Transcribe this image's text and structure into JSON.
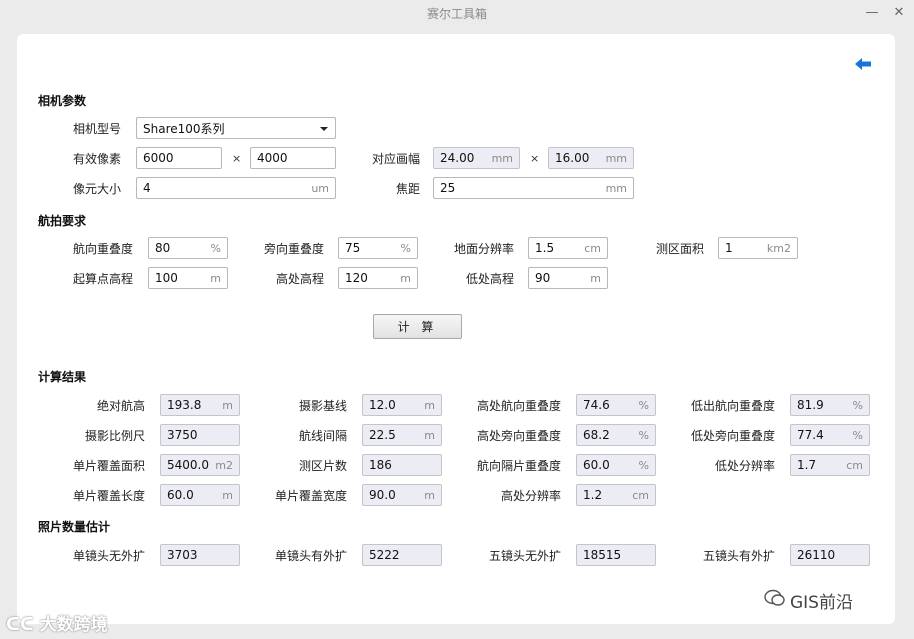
{
  "window": {
    "title": "赛尔工具箱",
    "minimize": "—",
    "close": "✕"
  },
  "colors": {
    "accent": "#1a73d9",
    "readonly_bg": "#ececf4"
  },
  "sections": {
    "camera": "相机参数",
    "flight": "航拍要求",
    "results": "计算结果",
    "photo_est": "照片数量估计"
  },
  "camera": {
    "model_label": "相机型号",
    "model_value": "Share100系列",
    "pixels_label": "有效像素",
    "pixels_w": "6000",
    "pixels_h": "4000",
    "frame_label": "对应画幅",
    "frame_w": "24.00",
    "frame_h": "16.00",
    "frame_unit": "mm",
    "pixel_size_label": "像元大小",
    "pixel_size": "4",
    "pixel_size_unit": "um",
    "focal_label": "焦距",
    "focal": "25",
    "focal_unit": "mm",
    "times": "×"
  },
  "flight": {
    "fwd_overlap_label": "航向重叠度",
    "fwd_overlap": "80",
    "pct": "%",
    "side_overlap_label": "旁向重叠度",
    "side_overlap": "75",
    "gsd_label": "地面分辨率",
    "gsd": "1.5",
    "gsd_unit": "cm",
    "area_label": "测区面积",
    "area": "1",
    "area_unit": "km2",
    "start_elev_label": "起算点高程",
    "start_elev": "100",
    "m": "m",
    "high_elev_label": "高处高程",
    "high_elev": "120",
    "low_elev_label": "低处高程",
    "low_elev": "90"
  },
  "calc_button": "计 算",
  "results": {
    "rel_alt_label": "绝对航高",
    "rel_alt": "193.8",
    "baseline_label": "摄影基线",
    "baseline": "12.0",
    "high_fwd_label": "高处航向重叠度",
    "high_fwd": "74.6",
    "low_fwd_label": "低出航向重叠度",
    "low_fwd": "81.9",
    "scale_label": "摄影比例尺",
    "scale": "3750",
    "line_spacing_label": "航线间隔",
    "line_spacing": "22.5",
    "high_side_label": "高处旁向重叠度",
    "high_side": "68.2",
    "low_side_label": "低处旁向重叠度",
    "low_side": "77.4",
    "cover_area_label": "单片覆盖面积",
    "cover_area": "5400.0",
    "cover_area_unit": "m2",
    "count_label": "测区片数",
    "count": "186",
    "skip_fwd_label": "航向隔片重叠度",
    "skip_fwd": "60.0",
    "low_gsd_label": "低处分辨率",
    "low_gsd": "1.7",
    "cm": "cm",
    "cover_len_label": "单片覆盖长度",
    "cover_len": "60.0",
    "cover_wid_label": "单片覆盖宽度",
    "cover_wid": "90.0",
    "high_gsd_label": "高处分辨率",
    "high_gsd": "1.2"
  },
  "photo_est": {
    "single_no_label": "单镜头无外扩",
    "single_no": "3703",
    "single_yes_label": "单镜头有外扩",
    "single_yes": "5222",
    "five_no_label": "五镜头无外扩",
    "five_no": "18515",
    "five_yes_label": "五镜头有外扩",
    "five_yes": "26110"
  },
  "watermarks": {
    "left": "大数跨境",
    "right": "GIS前沿"
  }
}
